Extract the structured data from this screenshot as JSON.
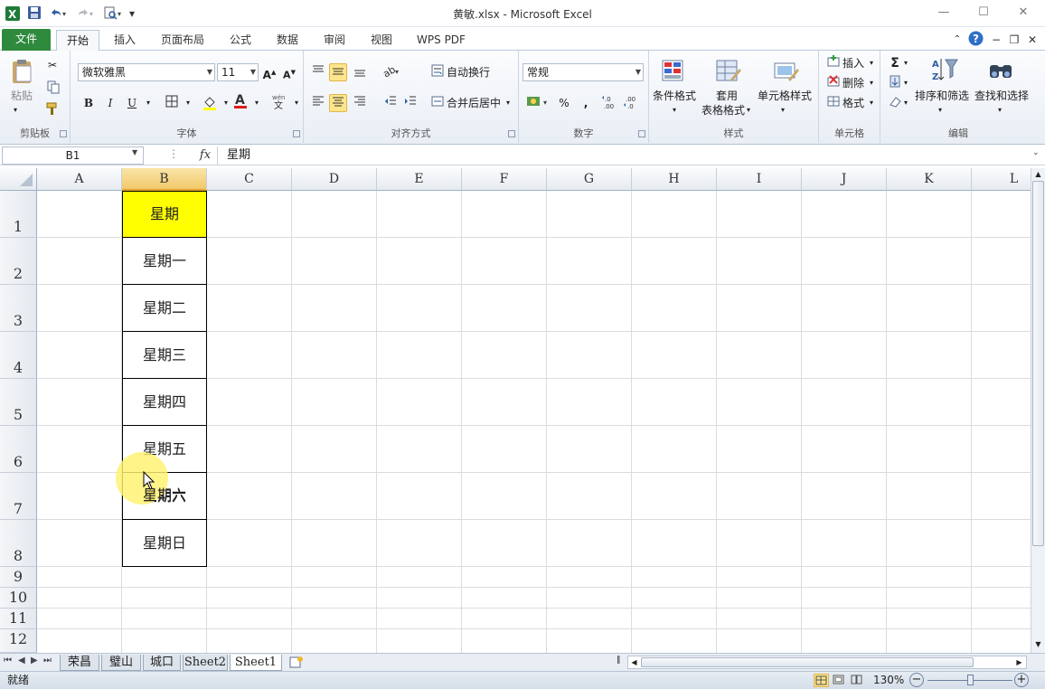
{
  "window": {
    "title": "黄敏.xlsx - Microsoft Excel"
  },
  "quick_access": {
    "app_icon": "excel-icon",
    "save": "save-icon",
    "undo": "undo-icon",
    "redo": "redo-icon",
    "print_preview": "print-preview-icon",
    "customize": "▾"
  },
  "tabs": [
    {
      "label": "文件"
    },
    {
      "label": "开始"
    },
    {
      "label": "插入"
    },
    {
      "label": "页面布局"
    },
    {
      "label": "公式"
    },
    {
      "label": "数据"
    },
    {
      "label": "审阅"
    },
    {
      "label": "视图"
    },
    {
      "label": "WPS PDF"
    }
  ],
  "ribbon": {
    "clipboard": {
      "group": "剪贴板",
      "paste": "粘贴"
    },
    "font": {
      "group": "字体",
      "name": "微软雅黑",
      "size": "11",
      "bold": "B",
      "italic": "I",
      "underline": "U"
    },
    "alignment": {
      "group": "对齐方式",
      "wrap": "自动换行",
      "merge": "合并后居中"
    },
    "number": {
      "group": "数字",
      "format": "常规",
      "percent": "%",
      "comma": ","
    },
    "styles": {
      "group": "样式",
      "conditional": "条件格式",
      "table1": "套用",
      "table2": "表格格式",
      "cell_styles": "单元格样式"
    },
    "cells": {
      "group": "单元格",
      "insert": "插入",
      "delete": "删除",
      "format": "格式"
    },
    "editing": {
      "group": "编辑",
      "sigma": "Σ",
      "sort": "排序和筛选",
      "find": "查找和选择"
    }
  },
  "formula_bar": {
    "name_box": "B1",
    "fx": "fx",
    "content": "星期"
  },
  "columns": [
    "A",
    "B",
    "C",
    "D",
    "E",
    "F",
    "G",
    "H",
    "I",
    "J",
    "K",
    "L"
  ],
  "selected_column": "B",
  "rows": [
    "1",
    "2",
    "3",
    "4",
    "5",
    "6",
    "7",
    "8",
    "9",
    "10",
    "11",
    "12"
  ],
  "cells": {
    "B1": "星期",
    "B2": "星期一",
    "B3": "星期二",
    "B4": "星期三",
    "B5": "星期四",
    "B6": "星期五",
    "B7": "星期六",
    "B8": "星期日"
  },
  "colors": {
    "header_fill": "#ffff00",
    "file_tab": "#2f8a3e"
  },
  "sheets": [
    "荣昌",
    "璧山",
    "城口",
    "Sheet2",
    "Sheet1"
  ],
  "active_sheet": "Sheet1",
  "status": {
    "mode": "就绪",
    "zoom": "130%"
  }
}
